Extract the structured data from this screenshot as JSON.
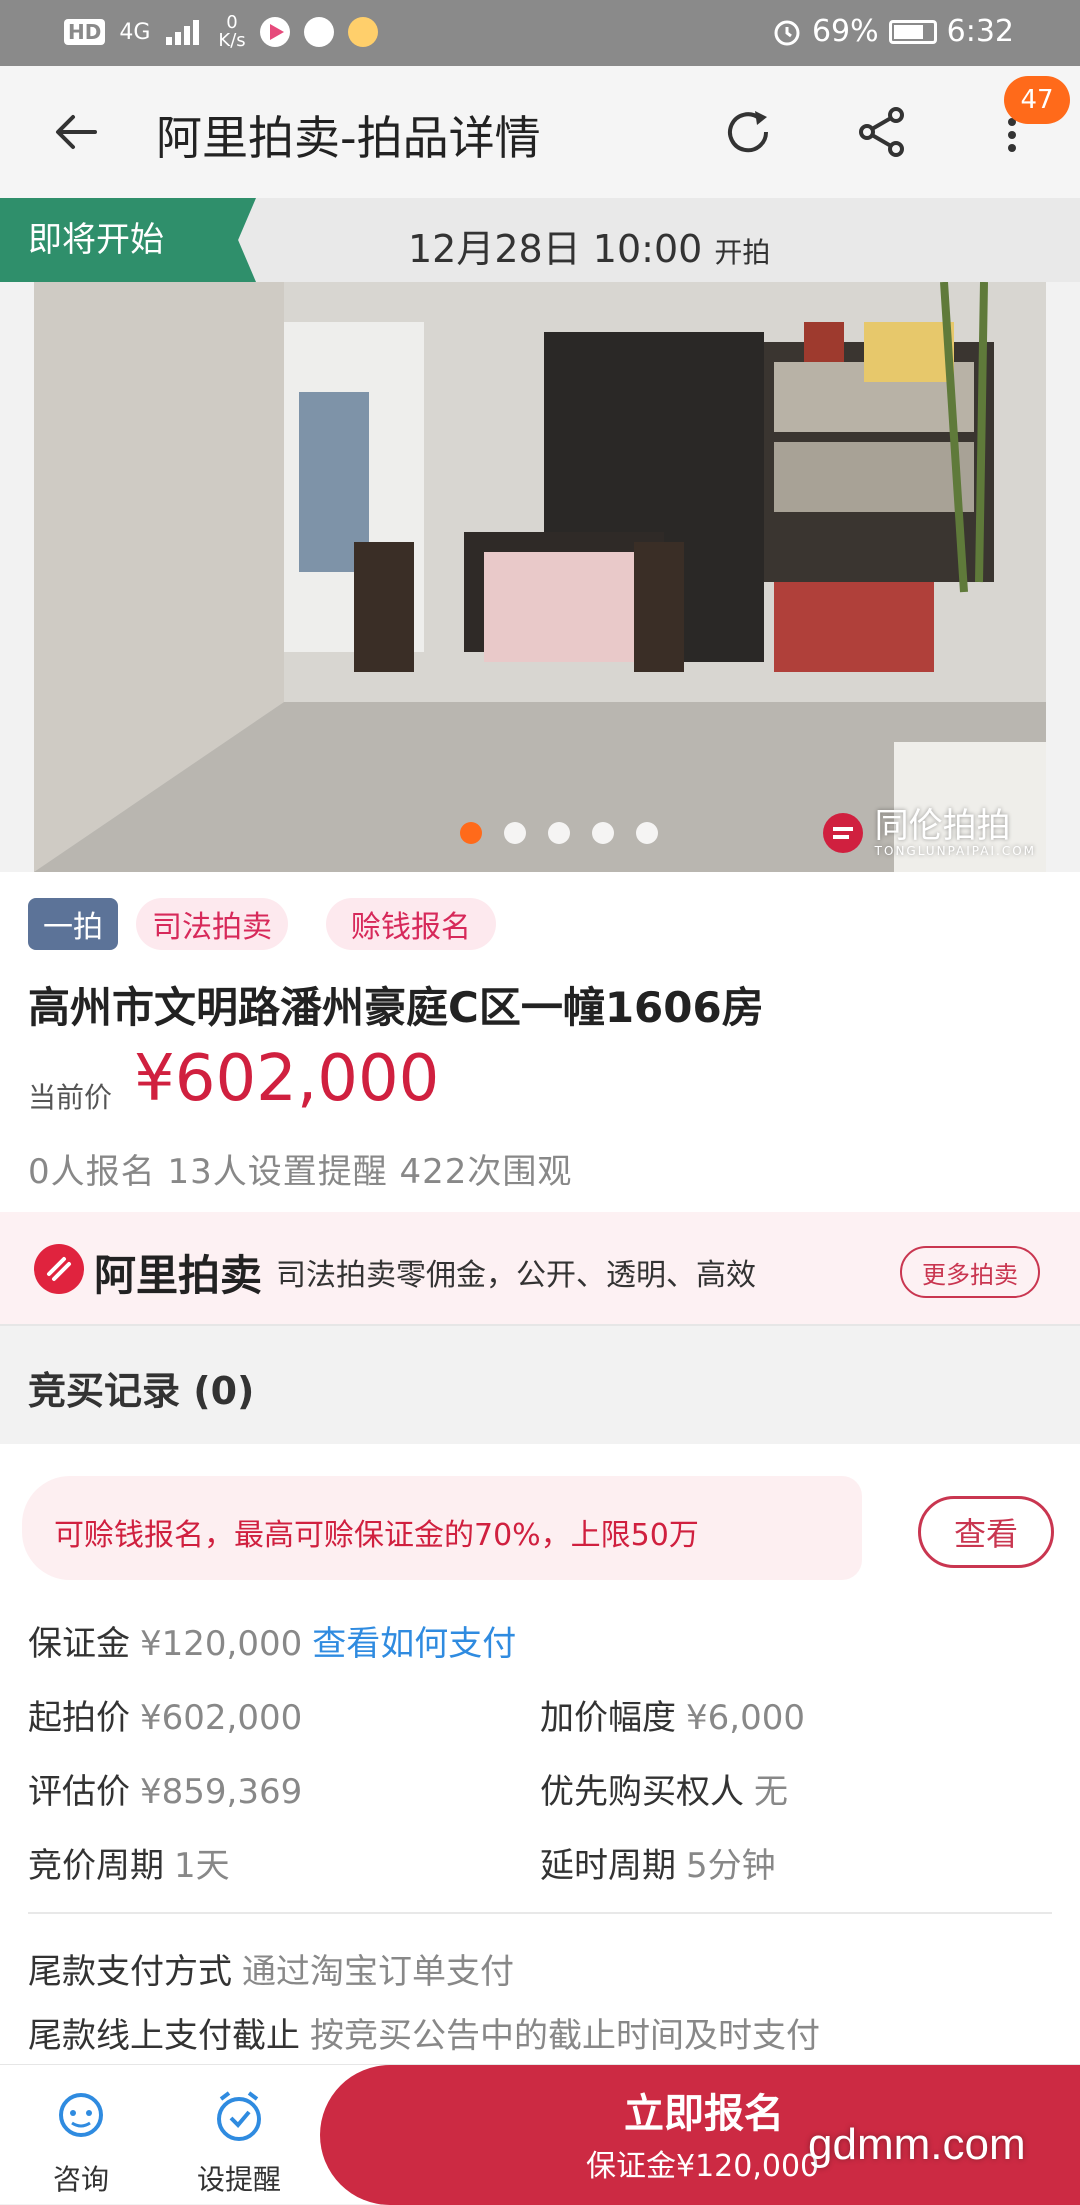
{
  "status_bar": {
    "network": "HD",
    "signal": "4G",
    "speed_value": "0",
    "speed_unit": "K/s",
    "battery": "69%",
    "time": "6:32"
  },
  "header": {
    "title": "阿里拍卖-拍品详情",
    "badge": "47"
  },
  "auction_strip": {
    "tag": "即将开始",
    "start_time": "12月28日 10:00",
    "start_suffix": "开拍"
  },
  "photo": {
    "watermark": "同伦拍拍",
    "watermark_sub": "TONGLUNPAIPAI.COM",
    "slides": 5,
    "active_slide": 1
  },
  "item": {
    "tag_round": "一拍",
    "tag_judicial": "司法拍卖",
    "tag_loan": "赊钱报名",
    "name": "高州市文明路潘州豪庭C区一幢1606房",
    "price_label": "当前价",
    "price": "¥602,000",
    "stats": "0人报名  13人设置提醒  422次围观"
  },
  "ali_banner": {
    "brand": "阿里拍卖",
    "slogan": "司法拍卖零佣金，公开、透明、高效",
    "more": "更多拍卖"
  },
  "bid_record": {
    "title": "竞买记录 (0)"
  },
  "details": {
    "notice": "可赊钱报名，最高可赊保证金的70%，上限50万",
    "view_btn": "查看",
    "deposit_label": "保证金",
    "deposit_value": "¥120,000",
    "deposit_link": "查看如何支付",
    "start_price_label": "起拍价",
    "start_price_value": "¥602,000",
    "increment_label": "加价幅度",
    "increment_value": "¥6,000",
    "appraisal_label": "评估价",
    "appraisal_value": "¥859,369",
    "priority_label": "优先购买权人",
    "priority_value": "无",
    "cycle_label": "竞价周期",
    "cycle_value": "1天",
    "delay_label": "延时周期",
    "delay_value": "5分钟",
    "final_pay_label": "尾款支付方式",
    "final_pay_value": "通过淘宝订单支付",
    "deadline_label": "尾款线上支付截止",
    "deadline_value": "按竞买公告中的截止时间及时支付"
  },
  "bottom_bar": {
    "consult": "咨询",
    "remind": "设提醒",
    "signup": "立即报名",
    "signup_sub": "保证金¥120,000"
  },
  "site_watermark": "gdmm.com",
  "colors": {
    "accent_red": "#cc2a43",
    "price_red": "#d0203f",
    "green_tag": "#2f8f6b",
    "badge_orange": "#ff6a1a",
    "link_blue": "#2f8be0"
  }
}
